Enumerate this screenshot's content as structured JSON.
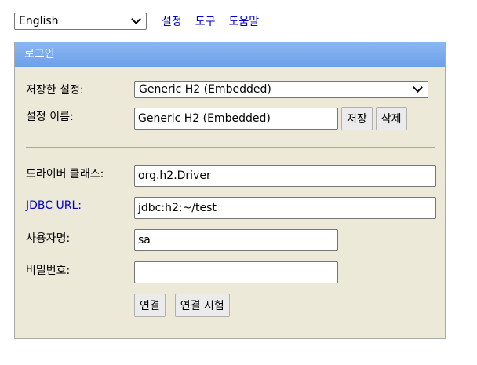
{
  "topbar": {
    "language": "English",
    "links": [
      "설정",
      "도구",
      "도움말"
    ]
  },
  "panel": {
    "title": "로그인",
    "saved_settings": {
      "label": "저장한 설정:",
      "value": "Generic H2 (Embedded)"
    },
    "setting_name": {
      "label": "설정 이름:",
      "value": "Generic H2 (Embedded)",
      "save_button": "저장",
      "delete_button": "삭제"
    },
    "driver_class": {
      "label": "드라이버 클래스:",
      "value": "org.h2.Driver"
    },
    "jdbc_url": {
      "label": "JDBC URL:",
      "value": "jdbc:h2:~/test"
    },
    "username": {
      "label": "사용자명:",
      "value": "sa"
    },
    "password": {
      "label": "비밀번호:",
      "value": ""
    },
    "connect_button": "연결",
    "test_connection_button": "연결 시험"
  },
  "colors": {
    "header_bg": "#7aa9ec",
    "panel_bg": "#ece9d8",
    "link": "#0000cc"
  }
}
